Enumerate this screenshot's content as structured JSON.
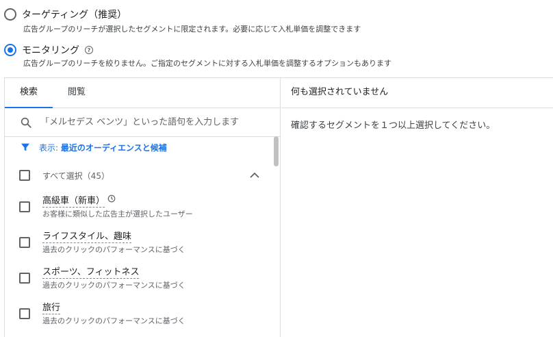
{
  "options": [
    {
      "label": "ターゲティング（推奨）",
      "description": "広告グループのリーチが選択したセグメントに限定されます。必要に応じて入札単価を調整できます",
      "selected": false
    },
    {
      "label": "モニタリング",
      "description": "広告グループのリーチを絞りません。ご指定のセグメントに対する入札単価を調整するオプションもあります",
      "selected": true,
      "help_icon": "?"
    }
  ],
  "tabs": [
    {
      "label": "検索",
      "active": true
    },
    {
      "label": "閲覧",
      "active": false
    }
  ],
  "search": {
    "placeholder": "「メルセデス ベンツ」といった語句を入力します"
  },
  "filter": {
    "prefix": "表示: ",
    "value": "最近のオーディエンスと候補"
  },
  "select_all": {
    "label": "すべて選択（45）"
  },
  "items": [
    {
      "title": "高級車（新車）",
      "description": "お客様に類似した広告主が選択したユーザー",
      "has_clock": true
    },
    {
      "title": "ライフスタイル、趣味",
      "description": "過去のクリックのパフォーマンスに基づく",
      "has_clock": false
    },
    {
      "title": "スポーツ、フィットネス",
      "description": "過去のクリックのパフォーマンスに基づく",
      "has_clock": false
    },
    {
      "title": "旅行",
      "description": "過去のクリックのパフォーマンスに基づく",
      "has_clock": false
    }
  ],
  "right_panel": {
    "header": "何も選択されていません",
    "message": "確認するセグメントを１つ以上選択してください。"
  },
  "colors": {
    "accent": "#1a73e8",
    "border": "#dadce0",
    "muted_text": "#5f6368"
  }
}
